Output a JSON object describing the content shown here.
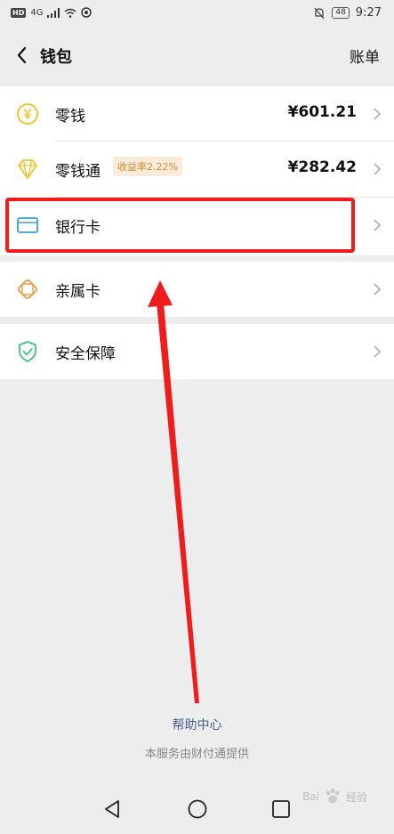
{
  "status_bar": {
    "badge": "HD",
    "network": "4G",
    "battery": "48",
    "time": "9:27"
  },
  "header": {
    "title": "钱包",
    "right_label": "账单"
  },
  "rows": {
    "change": {
      "label": "零钱",
      "amount": "¥601.21",
      "icon": "yuan-coin-icon"
    },
    "change_plus": {
      "label": "零钱通",
      "badge": "收益率2.22%",
      "amount": "¥282.42",
      "icon": "diamond-icon"
    },
    "bank_card": {
      "label": "银行卡",
      "icon": "bank-card-icon"
    },
    "family_card": {
      "label": "亲属卡",
      "icon": "family-card-icon"
    },
    "security": {
      "label": "安全保障",
      "icon": "shield-check-icon"
    }
  },
  "footer": {
    "help_link": "帮助中心",
    "provider": "本服务由财付通提供"
  },
  "watermark": {
    "brand": "Bai",
    "suffix": "经验"
  },
  "colors": {
    "accent_yellow": "#f2c230",
    "accent_blue": "#3a9fd8",
    "accent_orange": "#e4a04a",
    "accent_green": "#3cc082",
    "annotation_red": "#ee1c1c",
    "link": "#4a5f88"
  }
}
